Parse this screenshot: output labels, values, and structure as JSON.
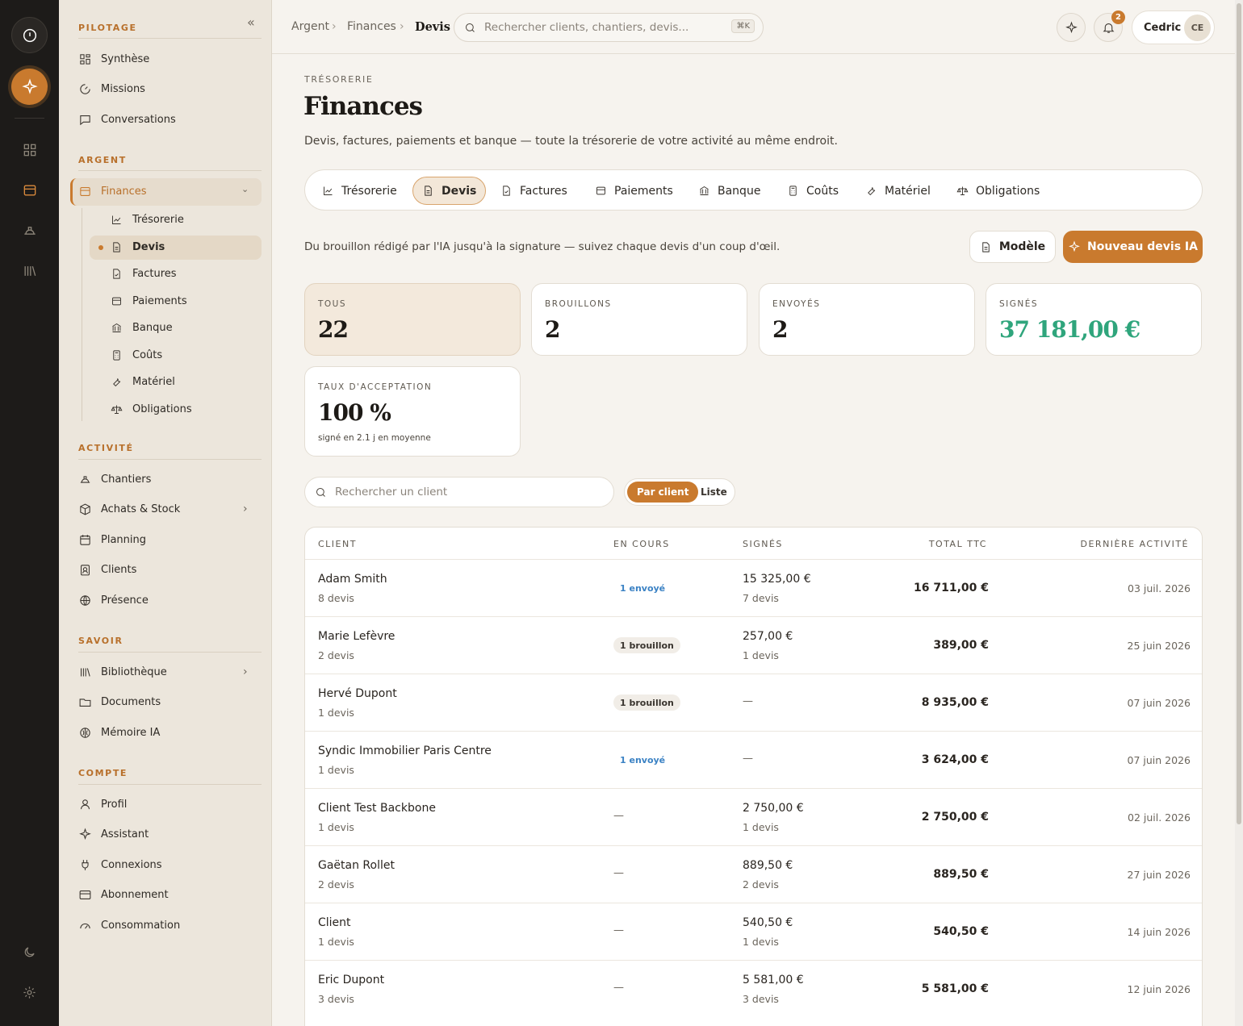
{
  "sidebar": {
    "sections": {
      "pilotage": "PILOTAGE",
      "argent": "ARGENT",
      "activite": "ACTIVITÉ",
      "savoir": "SAVOIR",
      "compte": "COMPTE"
    },
    "pilotage": [
      "Synthèse",
      "Missions",
      "Conversations"
    ],
    "finances": "Finances",
    "finances_sub": [
      "Trésorerie",
      "Devis",
      "Factures",
      "Paiements",
      "Banque",
      "Coûts",
      "Matériel",
      "Obligations"
    ],
    "activite": [
      "Chantiers",
      "Achats & Stock",
      "Planning",
      "Clients",
      "Présence"
    ],
    "savoir": [
      "Bibliothèque",
      "Documents",
      "Mémoire IA"
    ],
    "compte": [
      "Profil",
      "Assistant",
      "Connexions",
      "Abonnement",
      "Consommation"
    ]
  },
  "topbar": {
    "breadcrumb": [
      "Argent",
      "Finances",
      "Devis"
    ],
    "search_placeholder": "Rechercher clients, chantiers, devis...",
    "shortcut": "⌘K",
    "notifications": "2",
    "user_name": "Cedric",
    "user_initials": "CE"
  },
  "page": {
    "kicker": "TRÉSORERIE",
    "title": "Finances",
    "description": "Devis, factures, paiements et banque — toute la trésorerie de votre activité au même endroit.",
    "tabs": [
      "Trésorerie",
      "Devis",
      "Factures",
      "Paiements",
      "Banque",
      "Coûts",
      "Matériel",
      "Obligations"
    ],
    "active_tab": "Devis",
    "lead": "Du brouillon rédigé par l'IA jusqu'à la signature — suivez chaque devis d'un coup d'œil.",
    "btn_model": "Modèle",
    "btn_new": "Nouveau devis IA"
  },
  "stats": [
    {
      "label": "TOUS",
      "value": "22"
    },
    {
      "label": "BROUILLONS",
      "value": "2"
    },
    {
      "label": "ENVOYÉS",
      "value": "2"
    },
    {
      "label": "SIGNÉS",
      "value": "37 181,00 €"
    },
    {
      "label": "TAUX D'ACCEPTATION",
      "value": "100 %",
      "sub": "signé en 2.1 j en moyenne"
    }
  ],
  "filters": {
    "search_placeholder": "Rechercher un client",
    "view_by_client": "Par client",
    "view_list": "Liste"
  },
  "table": {
    "headers": [
      "CLIENT",
      "EN COURS",
      "SIGNÉS",
      "TOTAL TTC",
      "DERNIÈRE ACTIVITÉ"
    ],
    "rows": [
      {
        "client": "Adam Smith",
        "count": "8 devis",
        "en_cours": "1 envoyé",
        "status": "env",
        "signes": "15 325,00 €",
        "signes_count": "7 devis",
        "total": "16 711,00 €",
        "date": "03 juil. 2026"
      },
      {
        "client": "Marie Lefèvre",
        "count": "2 devis",
        "en_cours": "1 brouillon",
        "status": "br",
        "signes": "257,00 €",
        "signes_count": "1 devis",
        "total": "389,00 €",
        "date": "25 juin 2026"
      },
      {
        "client": "Hervé Dupont",
        "count": "1 devis",
        "en_cours": "1 brouillon",
        "status": "br",
        "signes": "—",
        "signes_count": "",
        "total": "8 935,00 €",
        "date": "07 juin 2026"
      },
      {
        "client": "Syndic Immobilier Paris Centre",
        "count": "1 devis",
        "en_cours": "1 envoyé",
        "status": "env",
        "signes": "—",
        "signes_count": "",
        "total": "3 624,00 €",
        "date": "07 juin 2026"
      },
      {
        "client": "Client Test Backbone",
        "count": "1 devis",
        "en_cours": "—",
        "status": "none",
        "signes": "2 750,00 €",
        "signes_count": "1 devis",
        "total": "2 750,00 €",
        "date": "02 juil. 2026"
      },
      {
        "client": "Gaëtan Rollet",
        "count": "2 devis",
        "en_cours": "—",
        "status": "none",
        "signes": "889,50 €",
        "signes_count": "2 devis",
        "total": "889,50 €",
        "date": "27 juin 2026"
      },
      {
        "client": "Client",
        "count": "1 devis",
        "en_cours": "—",
        "status": "none",
        "signes": "540,50 €",
        "signes_count": "1 devis",
        "total": "540,50 €",
        "date": "14 juin 2026"
      },
      {
        "client": "Eric Dupont",
        "count": "3 devis",
        "en_cours": "—",
        "status": "none",
        "signes": "5 581,00 €",
        "signes_count": "3 devis",
        "total": "5 581,00 €",
        "date": "12 juin 2026"
      }
    ]
  },
  "colors": {
    "accent": "#c97a2e",
    "success": "#2fa57c",
    "sent": "#3b82c4"
  }
}
